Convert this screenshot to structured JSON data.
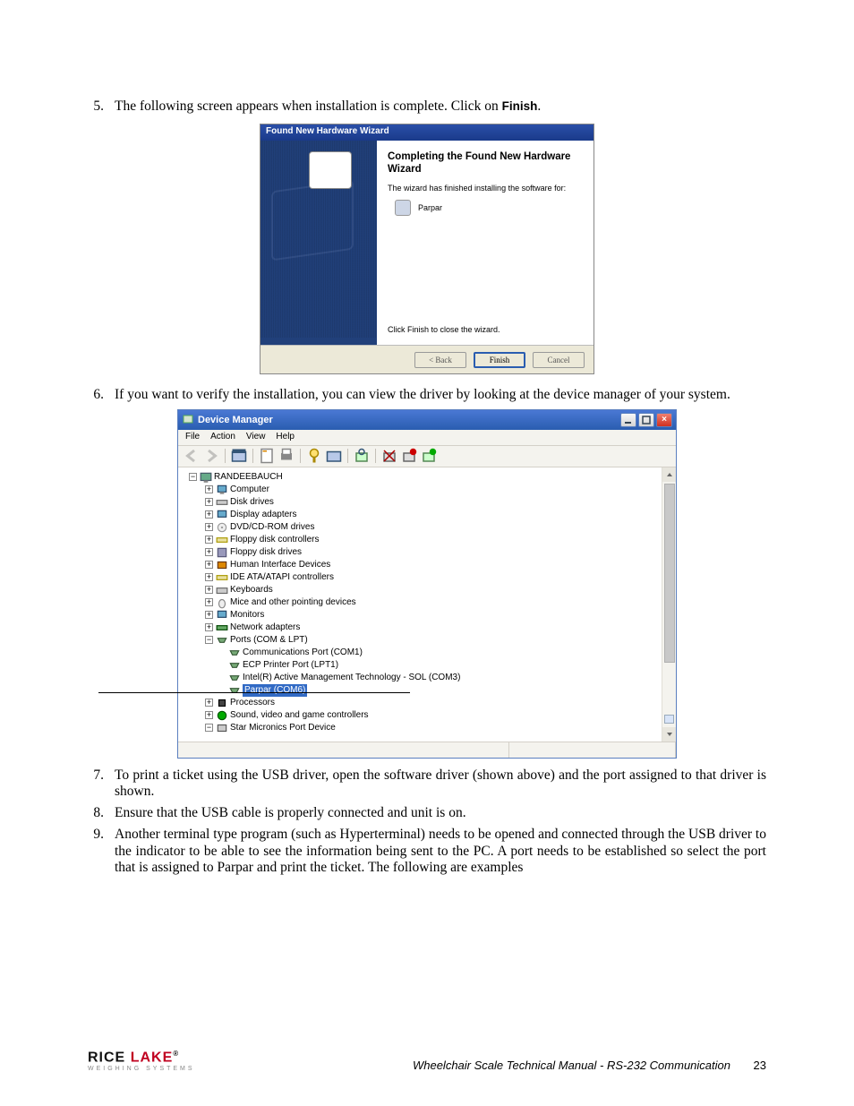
{
  "steps": {
    "s5": {
      "num": "5.",
      "text_a": "The following screen appears when installation is complete. Click on ",
      "finish": "Finish",
      "text_b": "."
    },
    "s6": {
      "num": "6.",
      "text": "If you want to verify the installation, you can view the driver by looking at the device manager of your system."
    },
    "s7": {
      "num": "7.",
      "text": "To print a ticket using the USB driver, open the software driver (shown above) and the port assigned to that driver is shown."
    },
    "s8": {
      "num": "8.",
      "text": "Ensure that the USB cable is properly connected and unit is on."
    },
    "s9": {
      "num": "9.",
      "text": "Another terminal type program (such as Hyperterminal) needs to be opened and connected through the USB driver to the indicator to be able to see the information being sent to the PC. A port needs to be established so select the port that is assigned to Parpar and print the ticket. The following are examples"
    }
  },
  "wizard": {
    "title": "Found New Hardware Wizard",
    "heading": "Completing the Found New Hardware Wizard",
    "sub": "The wizard has finished installing the software for:",
    "device": "Parpar",
    "close_hint": "Click Finish to close the wizard.",
    "btn_back": "< Back",
    "btn_finish": "Finish",
    "btn_cancel": "Cancel"
  },
  "dm": {
    "title": "Device Manager",
    "menu": {
      "file": "File",
      "action": "Action",
      "view": "View",
      "help": "Help"
    },
    "root": "RANDEEBAUCH",
    "nodes": {
      "computer": "Computer",
      "disk": "Disk drives",
      "display": "Display adapters",
      "dvd": "DVD/CD-ROM drives",
      "fdc": "Floppy disk controllers",
      "fdd": "Floppy disk drives",
      "hid": "Human Interface Devices",
      "ide": "IDE ATA/ATAPI controllers",
      "kbd": "Keyboards",
      "mice": "Mice and other pointing devices",
      "mon": "Monitors",
      "net": "Network adapters",
      "ports": "Ports (COM & LPT)",
      "com1": "Communications Port (COM1)",
      "lpt1": "ECP Printer Port (LPT1)",
      "sol": "Intel(R) Active Management Technology - SOL (COM3)",
      "parpar": "Parpar (COM6)",
      "proc": "Processors",
      "sound": "Sound, video and game controllers",
      "star": "Star Micronics Port Device"
    }
  },
  "footer": {
    "brand1a": "RICE",
    "brand1b": "LAKE",
    "brand_mark": "®",
    "brand2": "WEIGHING SYSTEMS",
    "doc": "Wheelchair Scale Technical Manual - RS-232 Communication",
    "page": "23"
  }
}
